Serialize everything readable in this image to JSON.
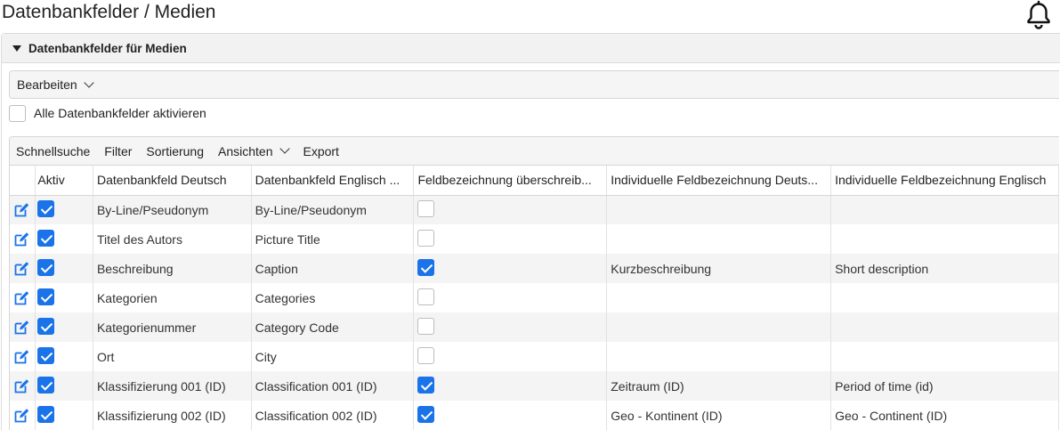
{
  "page": {
    "title": "Datenbankfelder / Medien"
  },
  "section": {
    "title": "Datenbankfelder für Medien"
  },
  "edit_menu": {
    "label": "Bearbeiten"
  },
  "activate_all": {
    "label": "Alle Datenbankfelder aktivieren",
    "checked": false
  },
  "toolbar": {
    "quick_search": "Schnellsuche",
    "filter": "Filter",
    "sort": "Sortierung",
    "views": "Ansichten",
    "export": "Export"
  },
  "table": {
    "columns": [
      "",
      "Aktiv",
      "Datenbankfeld Deutsch",
      "Datenbankfeld Englisch ...",
      "Feldbezeichnung überschreib...",
      "Individuelle Feldbezeichnung Deuts...",
      "Individuelle Feldbezeichnung Englisch"
    ],
    "rows": [
      {
        "active": true,
        "de": "By-Line/Pseudonym",
        "en": "By-Line/Pseudonym",
        "override": false,
        "custom_de": "",
        "custom_en": ""
      },
      {
        "active": true,
        "de": "Titel des Autors",
        "en": "Picture Title",
        "override": false,
        "custom_de": "",
        "custom_en": ""
      },
      {
        "active": true,
        "de": "Beschreibung",
        "en": "Caption",
        "override": true,
        "custom_de": "Kurzbeschreibung",
        "custom_en": "Short description"
      },
      {
        "active": true,
        "de": "Kategorien",
        "en": "Categories",
        "override": false,
        "custom_de": "",
        "custom_en": ""
      },
      {
        "active": true,
        "de": "Kategorienummer",
        "en": "Category Code",
        "override": false,
        "custom_de": "",
        "custom_en": ""
      },
      {
        "active": true,
        "de": "Ort",
        "en": "City",
        "override": false,
        "custom_de": "",
        "custom_en": ""
      },
      {
        "active": true,
        "de": "Klassifizierung 001 (ID)",
        "en": "Classification 001 (ID)",
        "override": true,
        "custom_de": "Zeitraum (ID)",
        "custom_en": "Period of time (id)"
      },
      {
        "active": true,
        "de": "Klassifizierung 002 (ID)",
        "en": "Classification 002 (ID)",
        "override": true,
        "custom_de": "Geo - Kontinent (ID)",
        "custom_en": "Geo - Continent (ID)"
      }
    ]
  },
  "icons": {
    "notifications": "bell-icon",
    "row_edit": "edit-icon",
    "collapse": "triangle-down-icon",
    "dropdown": "chevron-down-icon"
  },
  "colors": {
    "accent": "#1a73e8",
    "row_alt": "#f4f4f4",
    "header_bg": "#f2f2f2"
  }
}
